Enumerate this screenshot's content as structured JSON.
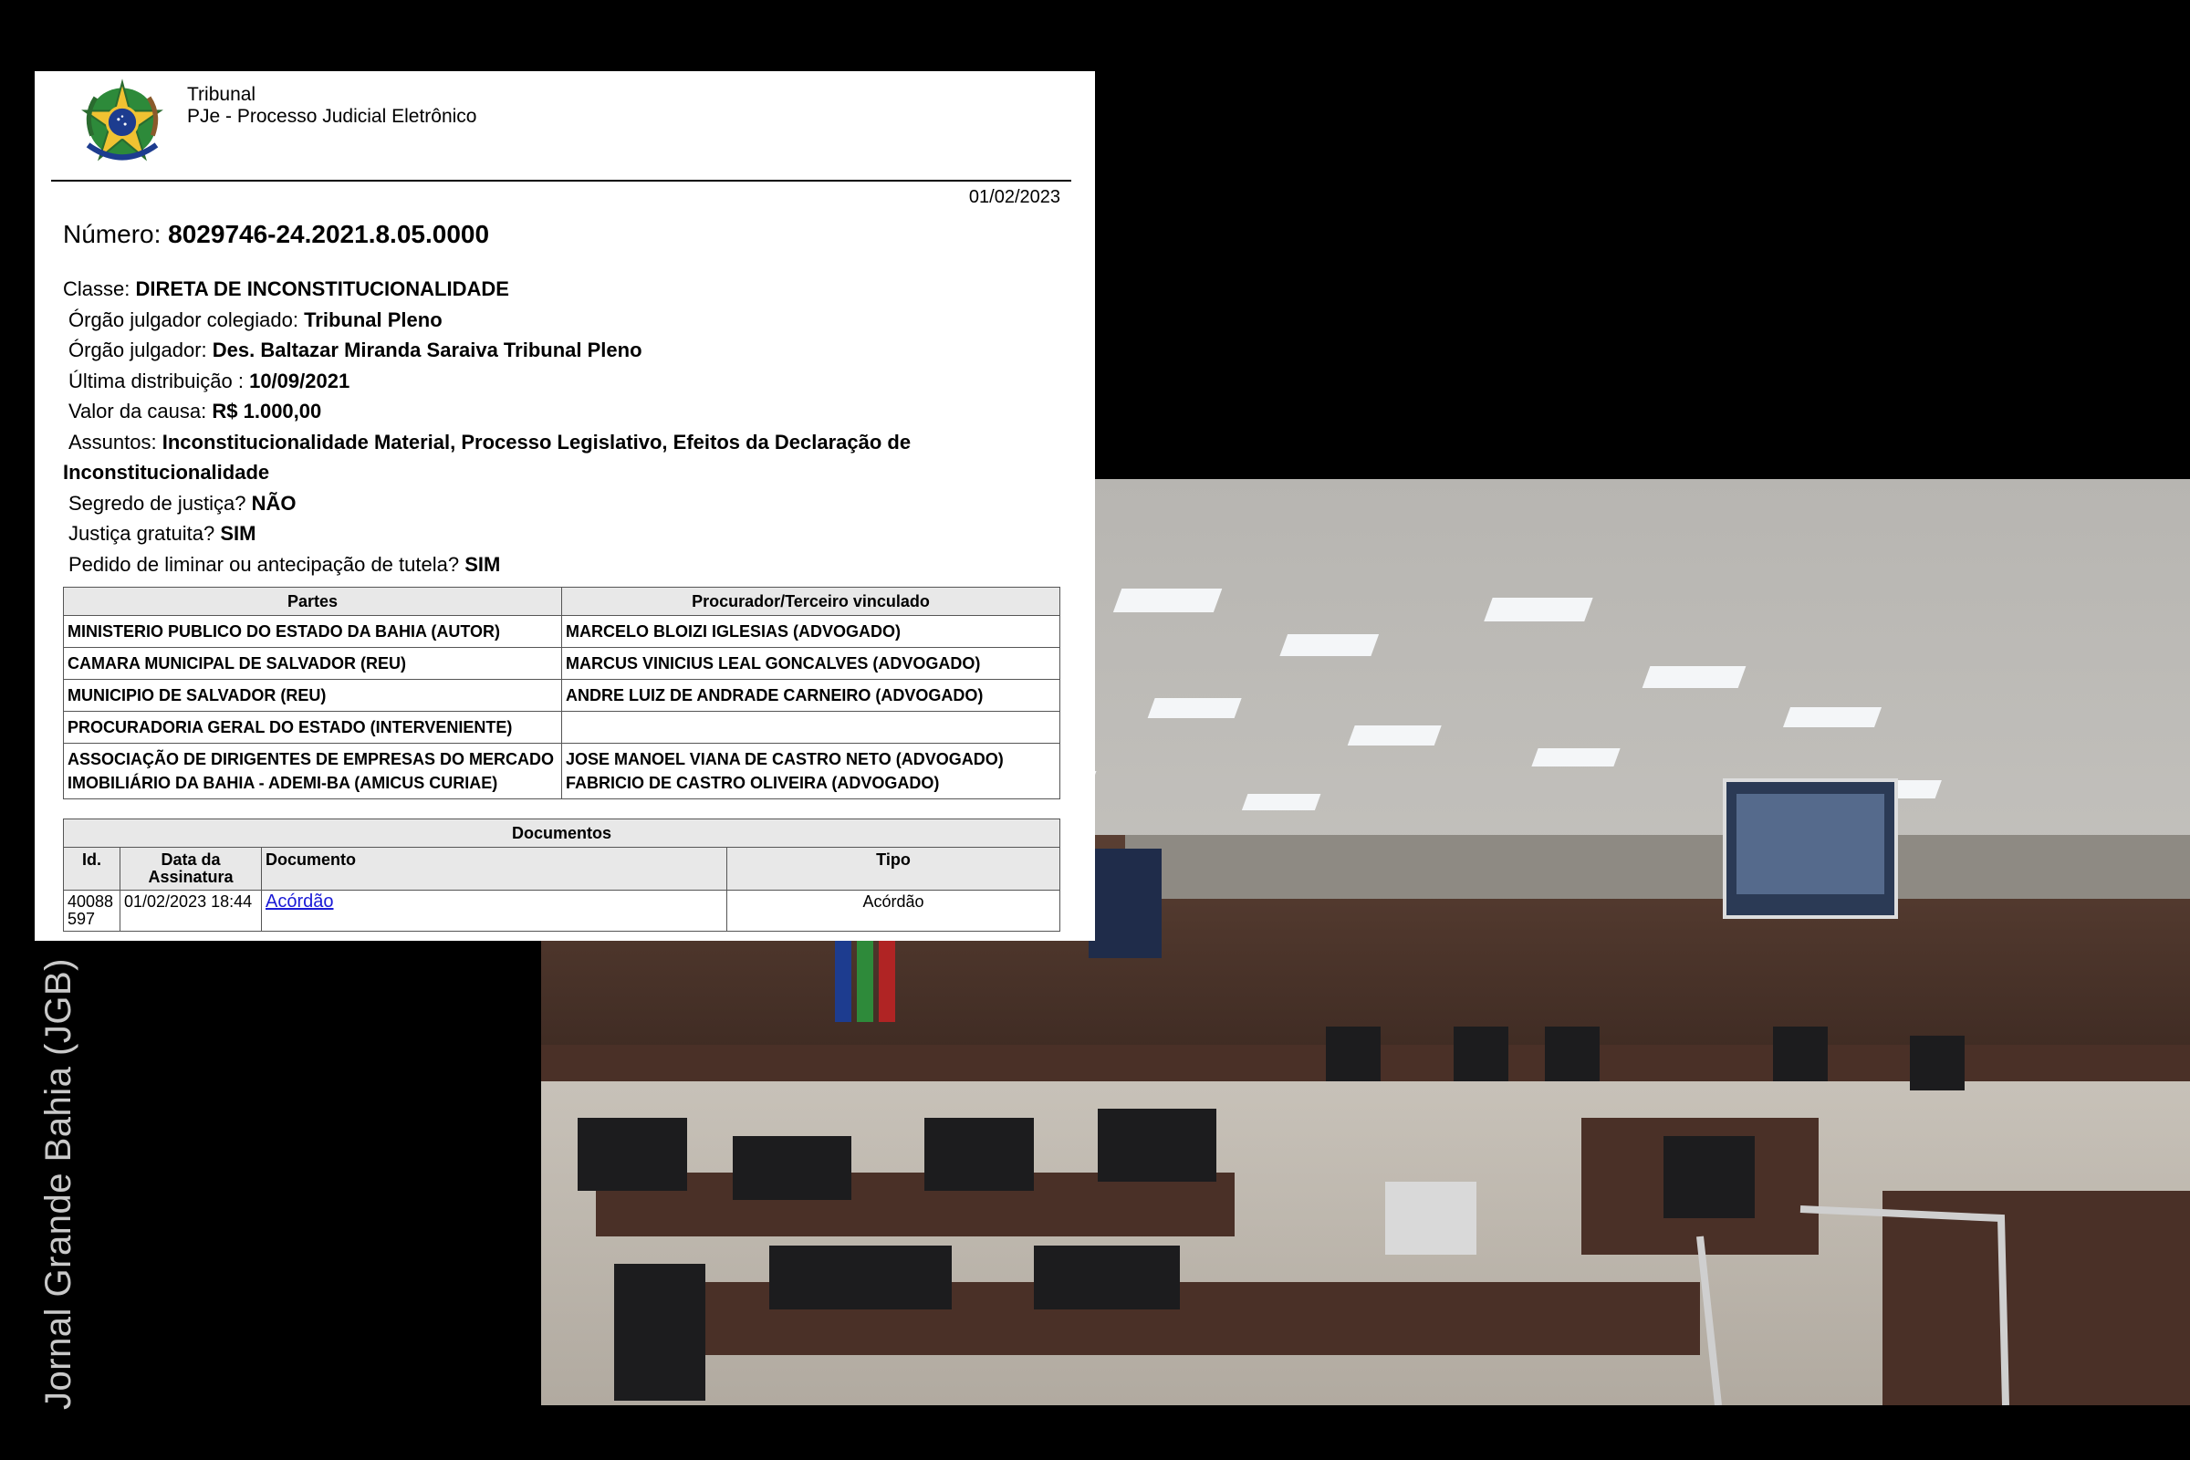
{
  "header": {
    "court_name": "Tribunal",
    "system_name": "PJe - Processo Judicial Eletrônico",
    "date": "01/02/2023",
    "crest_icon": "brazil-coat-of-arms-icon"
  },
  "numero": {
    "label": "Número:",
    "value": "8029746-24.2021.8.05.0000"
  },
  "fields": [
    {
      "label": "Classe:",
      "value": "DIRETA DE INCONSTITUCIONALIDADE"
    },
    {
      "label": "Órgão julgador colegiado:",
      "value": "Tribunal Pleno"
    },
    {
      "label": "Órgão julgador:",
      "value": "Des. Baltazar Miranda Saraiva Tribunal Pleno"
    },
    {
      "label": "Última distribuição :",
      "value": "10/09/2021"
    },
    {
      "label": "Valor da causa:",
      "value": "R$ 1.000,00"
    },
    {
      "label": "Assuntos:",
      "value": "Inconstitucionalidade Material, Processo Legislativo, Efeitos da Declaração de Inconstitucionalidade"
    },
    {
      "label": "Segredo de justiça?",
      "value": "NÃO"
    },
    {
      "label": "Justiça gratuita?",
      "value": "SIM"
    },
    {
      "label": "Pedido de liminar ou antecipação de tutela?",
      "value": "SIM"
    }
  ],
  "partes": {
    "headers": [
      "Partes",
      "Procurador/Terceiro vinculado"
    ],
    "rows": [
      {
        "parte": "MINISTERIO PUBLICO DO ESTADO DA BAHIA (AUTOR)",
        "procurador": [
          "MARCELO BLOIZI IGLESIAS (ADVOGADO)"
        ]
      },
      {
        "parte": "CAMARA MUNICIPAL DE SALVADOR (REU)",
        "procurador": [
          "MARCUS VINICIUS LEAL GONCALVES (ADVOGADO)"
        ]
      },
      {
        "parte": "MUNICIPIO DE SALVADOR (REU)",
        "procurador": [
          "ANDRE LUIZ DE ANDRADE CARNEIRO (ADVOGADO)"
        ]
      },
      {
        "parte": "PROCURADORIA GERAL DO ESTADO (INTERVENIENTE)",
        "procurador": []
      },
      {
        "parte": "ASSOCIAÇÃO DE DIRIGENTES DE EMPRESAS DO MERCADO IMOBILIÁRIO DA BAHIA - ADEMI-BA (AMICUS CURIAE)",
        "procurador": [
          "JOSE MANOEL VIANA DE CASTRO NETO (ADVOGADO)",
          "FABRICIO DE CASTRO OLIVEIRA (ADVOGADO)"
        ]
      }
    ]
  },
  "documentos": {
    "caption": "Documentos",
    "headers": {
      "id": "Id.",
      "data": "Data da Assinatura",
      "documento": "Documento",
      "tipo": "Tipo"
    },
    "rows": [
      {
        "id": "40088597",
        "data": "01/02/2023 18:44",
        "documento": "Acórdão",
        "tipo": "Acórdão"
      }
    ]
  },
  "photo_credit": "Jornal Grande Bahia (JGB)",
  "colors": {
    "link": "#1a1ad6",
    "table_header_bg": "#e8e8e8"
  }
}
